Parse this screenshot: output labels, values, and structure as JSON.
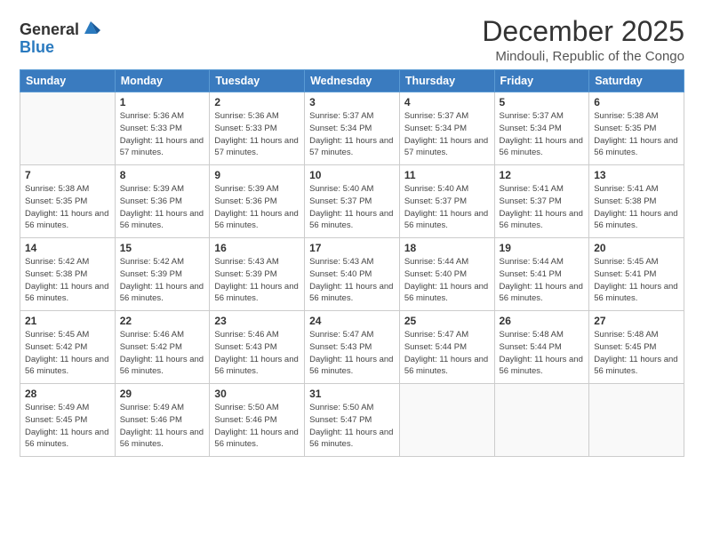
{
  "logo": {
    "general": "General",
    "blue": "Blue"
  },
  "title": "December 2025",
  "location": "Mindouli, Republic of the Congo",
  "weekdays": [
    "Sunday",
    "Monday",
    "Tuesday",
    "Wednesday",
    "Thursday",
    "Friday",
    "Saturday"
  ],
  "weeks": [
    [
      null,
      {
        "day": "1",
        "sunrise": "5:36 AM",
        "sunset": "5:33 PM",
        "daylight": "11 hours and 57 minutes."
      },
      {
        "day": "2",
        "sunrise": "5:36 AM",
        "sunset": "5:33 PM",
        "daylight": "11 hours and 57 minutes."
      },
      {
        "day": "3",
        "sunrise": "5:37 AM",
        "sunset": "5:34 PM",
        "daylight": "11 hours and 57 minutes."
      },
      {
        "day": "4",
        "sunrise": "5:37 AM",
        "sunset": "5:34 PM",
        "daylight": "11 hours and 57 minutes."
      },
      {
        "day": "5",
        "sunrise": "5:37 AM",
        "sunset": "5:34 PM",
        "daylight": "11 hours and 56 minutes."
      },
      {
        "day": "6",
        "sunrise": "5:38 AM",
        "sunset": "5:35 PM",
        "daylight": "11 hours and 56 minutes."
      }
    ],
    [
      {
        "day": "7",
        "sunrise": "5:38 AM",
        "sunset": "5:35 PM",
        "daylight": "11 hours and 56 minutes."
      },
      {
        "day": "8",
        "sunrise": "5:39 AM",
        "sunset": "5:36 PM",
        "daylight": "11 hours and 56 minutes."
      },
      {
        "day": "9",
        "sunrise": "5:39 AM",
        "sunset": "5:36 PM",
        "daylight": "11 hours and 56 minutes."
      },
      {
        "day": "10",
        "sunrise": "5:40 AM",
        "sunset": "5:37 PM",
        "daylight": "11 hours and 56 minutes."
      },
      {
        "day": "11",
        "sunrise": "5:40 AM",
        "sunset": "5:37 PM",
        "daylight": "11 hours and 56 minutes."
      },
      {
        "day": "12",
        "sunrise": "5:41 AM",
        "sunset": "5:37 PM",
        "daylight": "11 hours and 56 minutes."
      },
      {
        "day": "13",
        "sunrise": "5:41 AM",
        "sunset": "5:38 PM",
        "daylight": "11 hours and 56 minutes."
      }
    ],
    [
      {
        "day": "14",
        "sunrise": "5:42 AM",
        "sunset": "5:38 PM",
        "daylight": "11 hours and 56 minutes."
      },
      {
        "day": "15",
        "sunrise": "5:42 AM",
        "sunset": "5:39 PM",
        "daylight": "11 hours and 56 minutes."
      },
      {
        "day": "16",
        "sunrise": "5:43 AM",
        "sunset": "5:39 PM",
        "daylight": "11 hours and 56 minutes."
      },
      {
        "day": "17",
        "sunrise": "5:43 AM",
        "sunset": "5:40 PM",
        "daylight": "11 hours and 56 minutes."
      },
      {
        "day": "18",
        "sunrise": "5:44 AM",
        "sunset": "5:40 PM",
        "daylight": "11 hours and 56 minutes."
      },
      {
        "day": "19",
        "sunrise": "5:44 AM",
        "sunset": "5:41 PM",
        "daylight": "11 hours and 56 minutes."
      },
      {
        "day": "20",
        "sunrise": "5:45 AM",
        "sunset": "5:41 PM",
        "daylight": "11 hours and 56 minutes."
      }
    ],
    [
      {
        "day": "21",
        "sunrise": "5:45 AM",
        "sunset": "5:42 PM",
        "daylight": "11 hours and 56 minutes."
      },
      {
        "day": "22",
        "sunrise": "5:46 AM",
        "sunset": "5:42 PM",
        "daylight": "11 hours and 56 minutes."
      },
      {
        "day": "23",
        "sunrise": "5:46 AM",
        "sunset": "5:43 PM",
        "daylight": "11 hours and 56 minutes."
      },
      {
        "day": "24",
        "sunrise": "5:47 AM",
        "sunset": "5:43 PM",
        "daylight": "11 hours and 56 minutes."
      },
      {
        "day": "25",
        "sunrise": "5:47 AM",
        "sunset": "5:44 PM",
        "daylight": "11 hours and 56 minutes."
      },
      {
        "day": "26",
        "sunrise": "5:48 AM",
        "sunset": "5:44 PM",
        "daylight": "11 hours and 56 minutes."
      },
      {
        "day": "27",
        "sunrise": "5:48 AM",
        "sunset": "5:45 PM",
        "daylight": "11 hours and 56 minutes."
      }
    ],
    [
      {
        "day": "28",
        "sunrise": "5:49 AM",
        "sunset": "5:45 PM",
        "daylight": "11 hours and 56 minutes."
      },
      {
        "day": "29",
        "sunrise": "5:49 AM",
        "sunset": "5:46 PM",
        "daylight": "11 hours and 56 minutes."
      },
      {
        "day": "30",
        "sunrise": "5:50 AM",
        "sunset": "5:46 PM",
        "daylight": "11 hours and 56 minutes."
      },
      {
        "day": "31",
        "sunrise": "5:50 AM",
        "sunset": "5:47 PM",
        "daylight": "11 hours and 56 minutes."
      },
      null,
      null,
      null
    ]
  ]
}
